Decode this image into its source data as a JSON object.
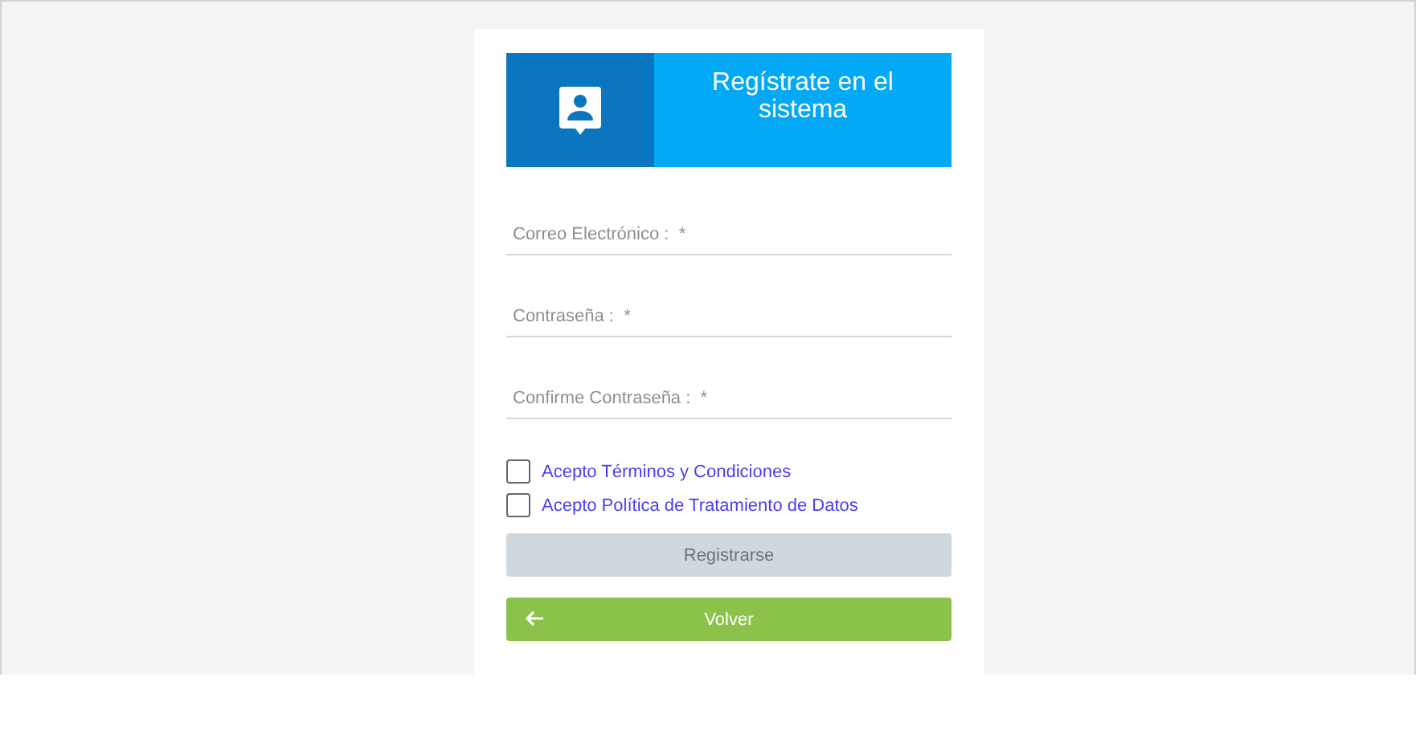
{
  "header": {
    "title": "Regístrate en el sistema"
  },
  "fields": [
    {
      "placeholder": "Correo Electrónico :  *"
    },
    {
      "placeholder": "Contraseña :  *"
    },
    {
      "placeholder": "Confirme Contraseña :  *"
    }
  ],
  "agreements": [
    {
      "label": "Acepto Términos y Condiciones",
      "checked": false
    },
    {
      "label": "Acepto Política de Tratamiento de Datos",
      "checked": false
    }
  ],
  "buttons": [
    {
      "kind": "submit",
      "label": "Registrarse",
      "disabled": true
    },
    {
      "kind": "back",
      "label": "Volver",
      "disabled": false
    }
  ]
}
